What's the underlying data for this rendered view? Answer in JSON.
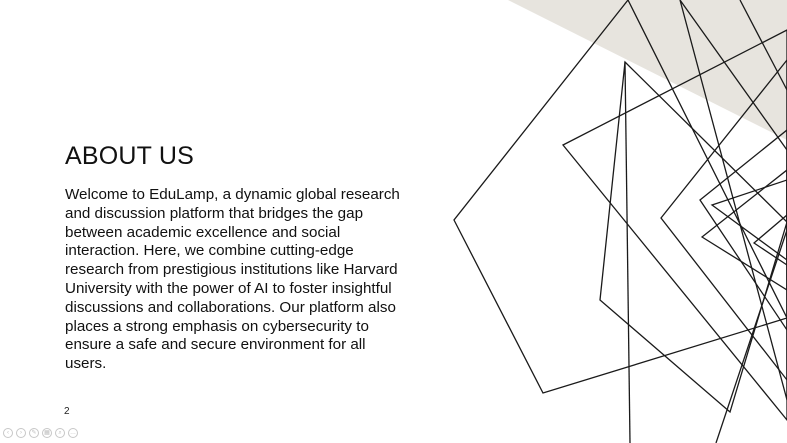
{
  "slide": {
    "title": "ABOUT US",
    "body": "Welcome to EduLamp, a dynamic global research and discussion platform that bridges the gap between academic excellence and social interaction. Here, we combine cutting-edge research from prestigious institutions like Harvard University with the power of AI to foster insightful discussions and collaborations. Our platform also places a strong emphasis on cybersecurity to ensure a safe and secure environment for all users.",
    "page_number": "2"
  },
  "player_controls": [
    {
      "icon": "previous-slide-icon",
      "glyph": "‹"
    },
    {
      "icon": "next-slide-icon",
      "glyph": "›"
    },
    {
      "icon": "pen-icon",
      "glyph": "✎"
    },
    {
      "icon": "slides-grid-icon",
      "glyph": "▦"
    },
    {
      "icon": "zoom-icon",
      "glyph": "⌕"
    },
    {
      "icon": "more-options-icon",
      "glyph": "…"
    }
  ],
  "colors": {
    "background": "#ffffff",
    "accent_shape": "#e7e4de",
    "line": "#1a1a1a",
    "text": "#111111"
  }
}
